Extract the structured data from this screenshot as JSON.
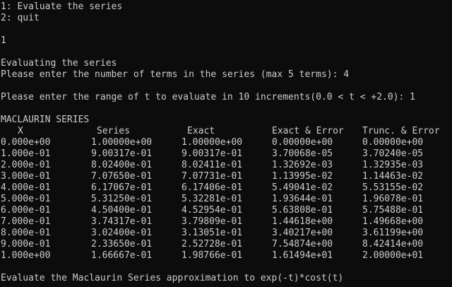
{
  "menu": {
    "option1": "1: Evaluate the series",
    "option2": "2: quit"
  },
  "choice": "1",
  "evaluating": "Evaluating the series",
  "terms_prompt": "Please enter the number of terms in the series (max 5 terms): 4",
  "range_prompt": "Please enter the range of t to evaluate in 10 increments(0.0 < t < +2.0): 1",
  "table_title": "MACLAURIN SERIES",
  "columns": [
    "X",
    "Series",
    "Exact",
    "Exact & Error",
    "Trunc. & Error"
  ],
  "rows": [
    [
      "0.000e+00",
      "1.00000e+00",
      "1.00000e+00",
      "0.00000e+00",
      "0.00000e+00"
    ],
    [
      "1.000e-01",
      "9.00317e-01",
      "9.00317e-01",
      "3.70068e-05",
      "3.70240e-05"
    ],
    [
      "2.000e-01",
      "8.02400e-01",
      "8.02411e-01",
      "1.32692e-03",
      "1.32935e-03"
    ],
    [
      "3.000e-01",
      "7.07650e-01",
      "7.07731e-01",
      "1.13995e-02",
      "1.14463e-02"
    ],
    [
      "4.000e-01",
      "6.17067e-01",
      "6.17406e-01",
      "5.49041e-02",
      "5.53155e-02"
    ],
    [
      "5.000e-01",
      "5.31250e-01",
      "5.32281e-01",
      "1.93644e-01",
      "1.96078e-01"
    ],
    [
      "6.000e-01",
      "4.50400e-01",
      "4.52954e-01",
      "5.63808e-01",
      "5.75488e-01"
    ],
    [
      "7.000e-01",
      "3.74317e-01",
      "3.79809e-01",
      "1.44618e+00",
      "1.49668e+00"
    ],
    [
      "8.000e-01",
      "3.02400e-01",
      "3.13051e-01",
      "3.40217e+00",
      "3.61199e+00"
    ],
    [
      "9.000e-01",
      "2.33650e-01",
      "2.52728e-01",
      "7.54874e+00",
      "8.42414e+00"
    ],
    [
      "1.000e+00",
      "1.66667e-01",
      "1.98766e-01",
      "1.61494e+01",
      "2.00000e+01"
    ]
  ],
  "footer": "Evaluate the Maclaurin Series approximation to exp(-t)*cost(t)"
}
